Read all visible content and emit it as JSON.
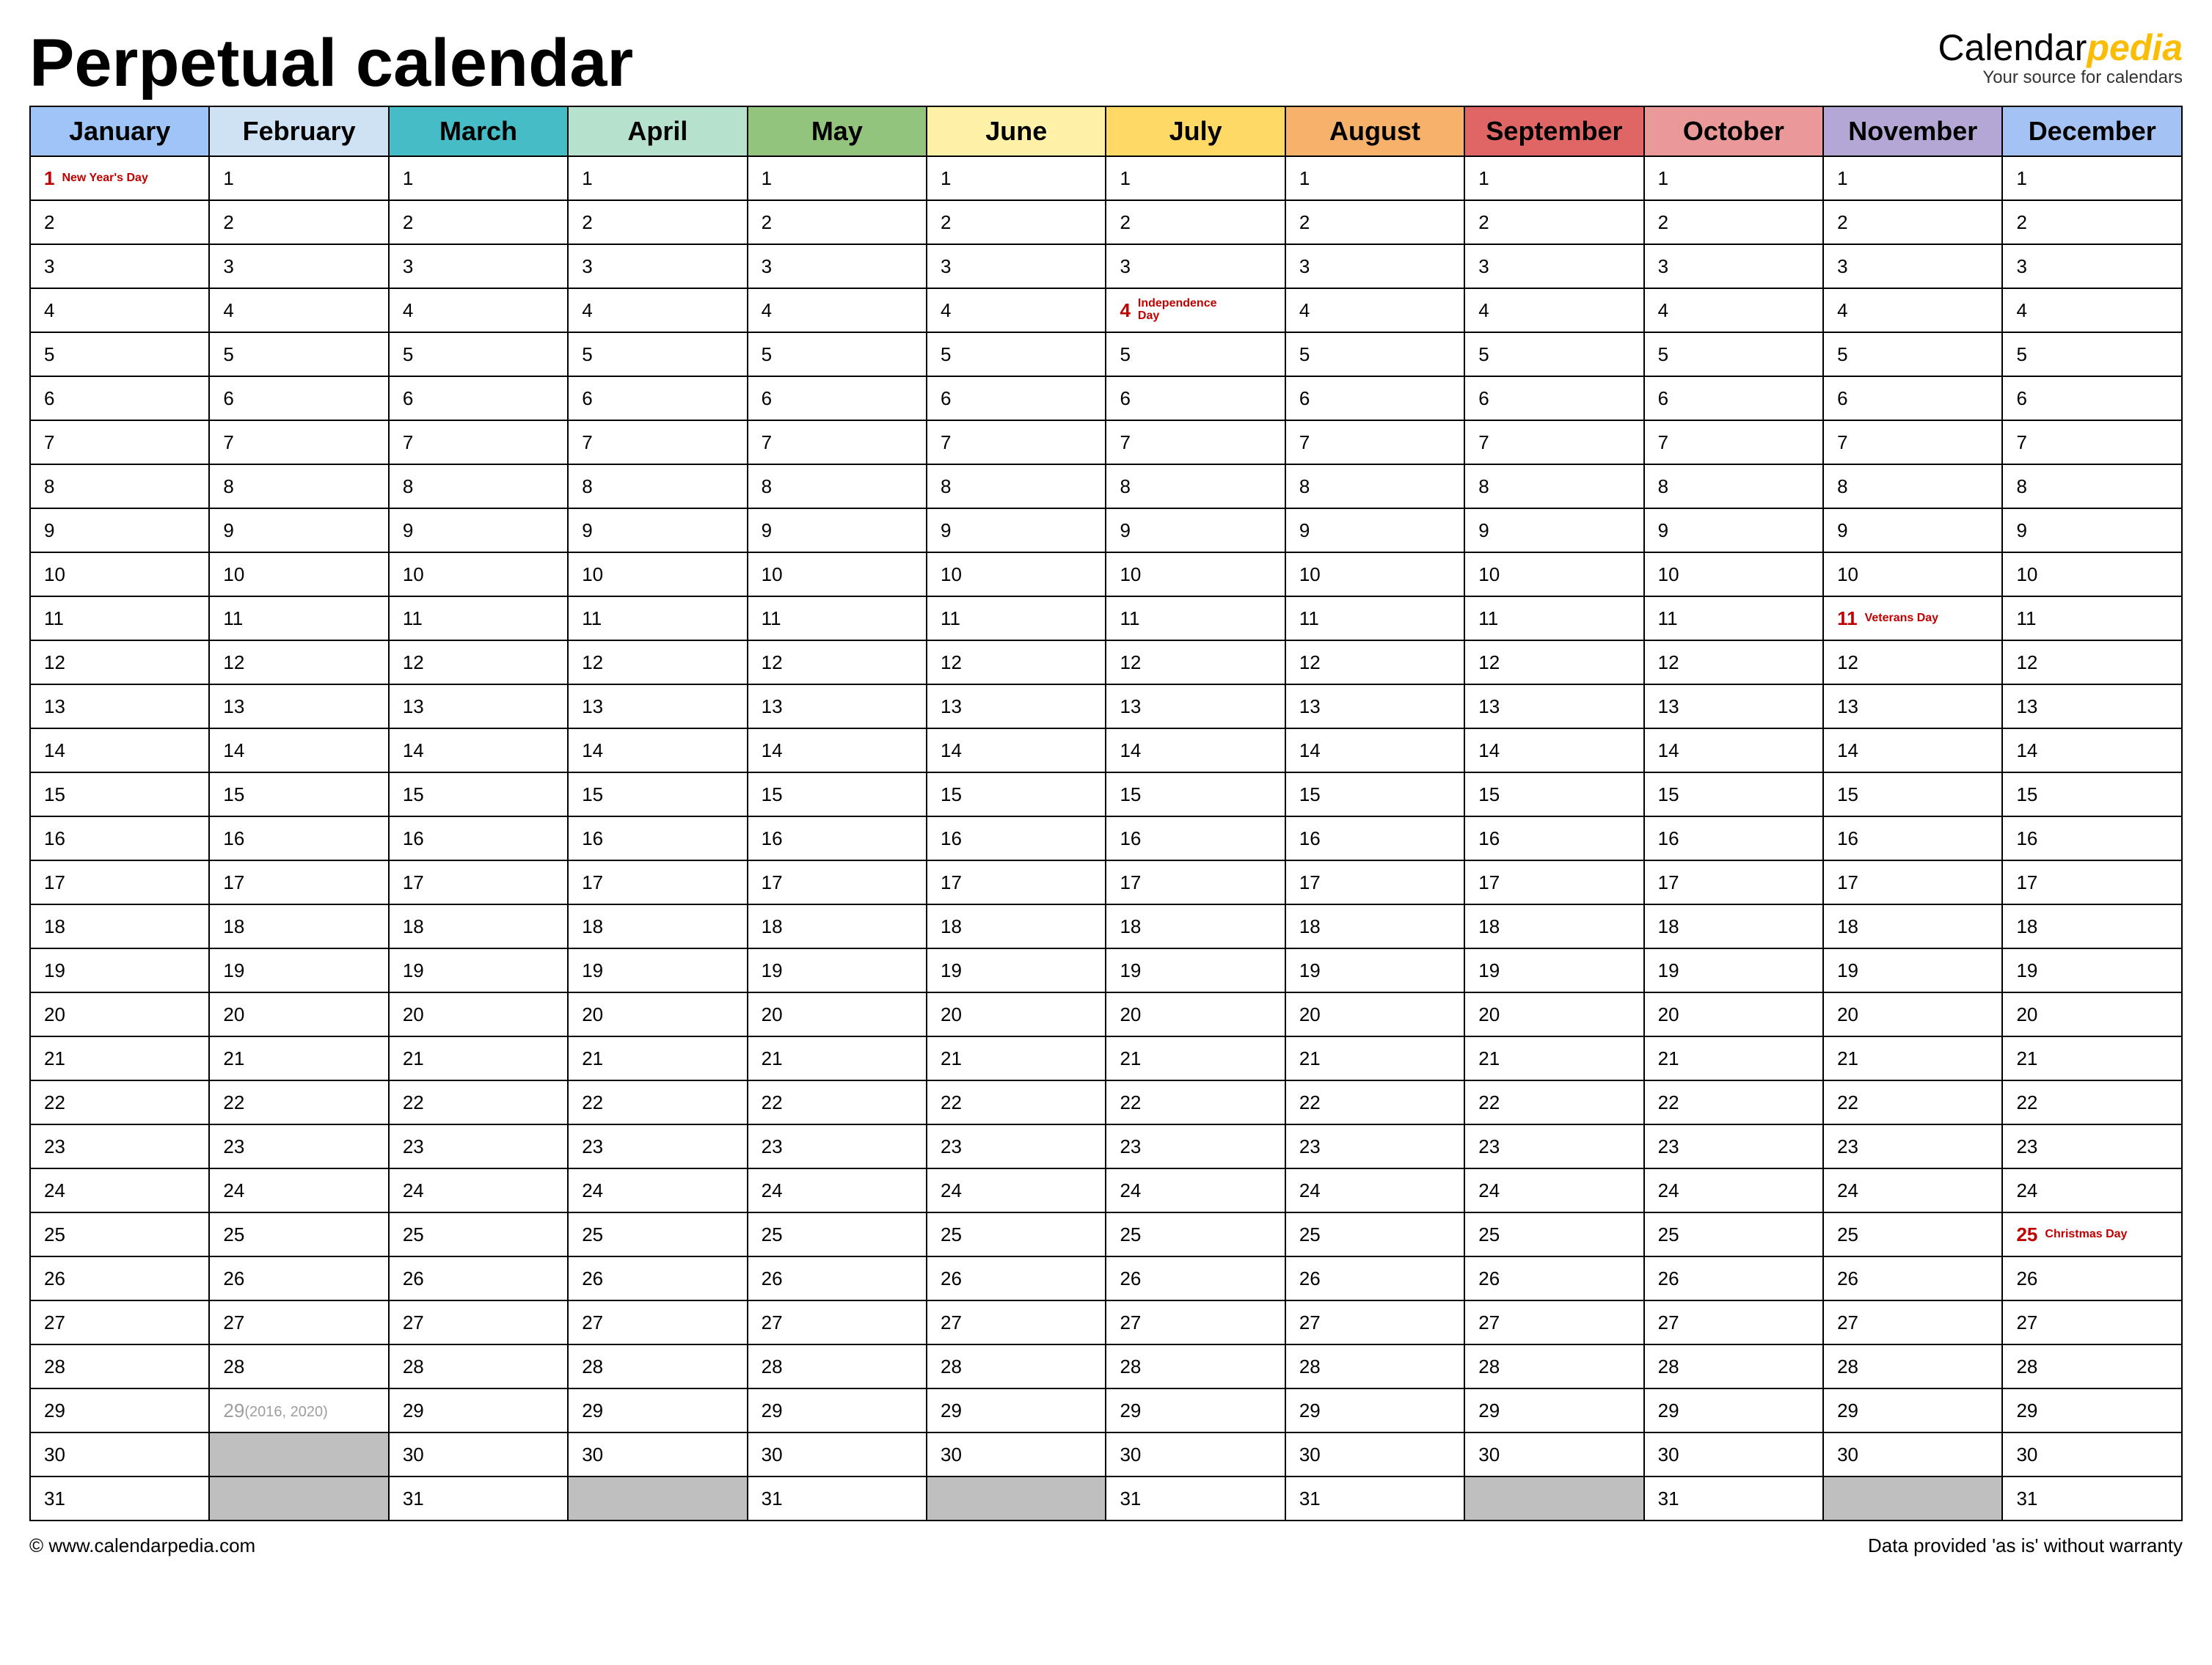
{
  "title": "Perpetual calendar",
  "logo": {
    "brand_a": "Calendar",
    "brand_b": "pedia",
    "tagline": "Your source for calendars"
  },
  "footer": {
    "left": "© www.calendarpedia.com",
    "right": "Data provided 'as is' without warranty"
  },
  "months": [
    {
      "name": "January",
      "color": "#9fc5f8",
      "days": 31
    },
    {
      "name": "February",
      "color": "#cfe2f3",
      "days": 28,
      "leap": {
        "day": 29,
        "note": "(2016, 2020)"
      }
    },
    {
      "name": "March",
      "color": "#46bdc6",
      "days": 31
    },
    {
      "name": "April",
      "color": "#b6e1cd",
      "days": 30
    },
    {
      "name": "May",
      "color": "#93c47d",
      "days": 31
    },
    {
      "name": "June",
      "color": "#fff2a8",
      "days": 30
    },
    {
      "name": "July",
      "color": "#ffd966",
      "days": 31
    },
    {
      "name": "August",
      "color": "#f6b26b",
      "days": 31
    },
    {
      "name": "September",
      "color": "#e06666",
      "days": 30
    },
    {
      "name": "October",
      "color": "#ea9999",
      "days": 31
    },
    {
      "name": "November",
      "color": "#b4a7d6",
      "days": 30
    },
    {
      "name": "December",
      "color": "#a4c2f4",
      "days": 31
    }
  ],
  "holidays": [
    {
      "month": 0,
      "day": 1,
      "label": "New Year's Day"
    },
    {
      "month": 6,
      "day": 4,
      "label": "Independence Day"
    },
    {
      "month": 10,
      "day": 11,
      "label": "Veterans Day"
    },
    {
      "month": 11,
      "day": 25,
      "label": "Christmas Day"
    }
  ],
  "max_rows": 31
}
